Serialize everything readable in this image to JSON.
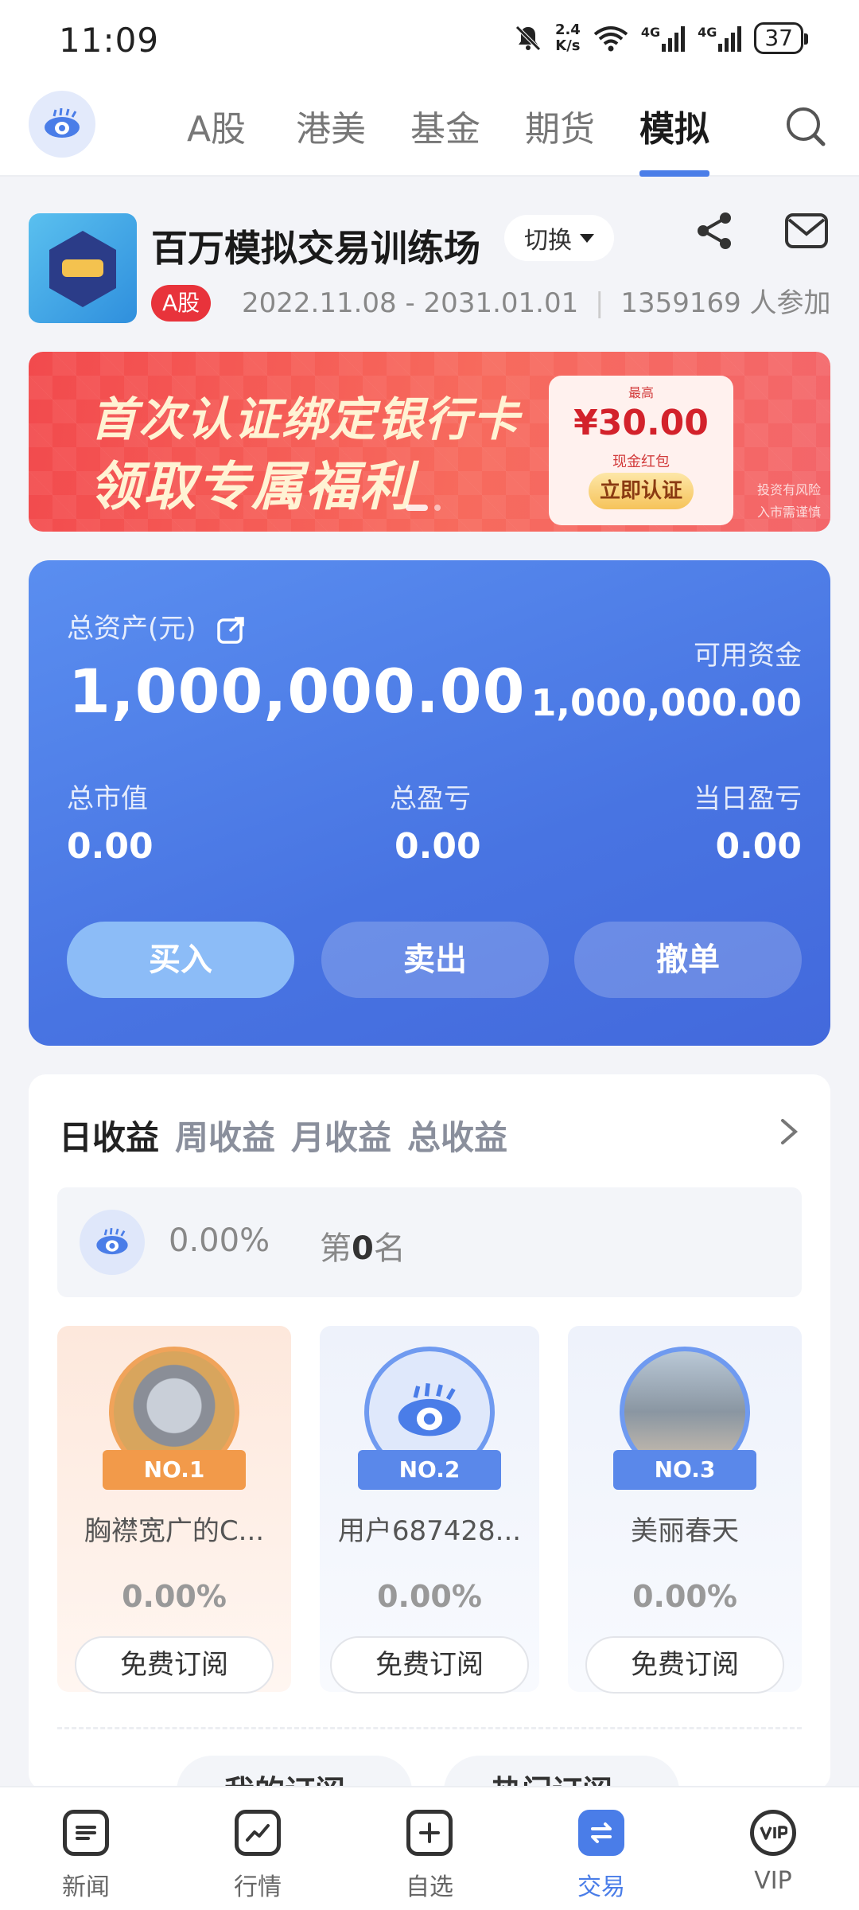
{
  "status_bar": {
    "time": "11:09",
    "speed_top": "2.4",
    "speed_bottom": "K/s",
    "net1": "4G",
    "net2": "4G",
    "battery": "37"
  },
  "top_nav": {
    "tabs": [
      {
        "label": "A股"
      },
      {
        "label": "港美"
      },
      {
        "label": "基金"
      },
      {
        "label": "期货"
      },
      {
        "label": "模拟"
      }
    ],
    "active_tab": "模拟"
  },
  "contest": {
    "title": "百万模拟交易训练场",
    "switch_label": "切换",
    "market_tag": "A股",
    "period": "2022.11.08 - 2031.01.01",
    "separator": "|",
    "participants": "1359169 人参加"
  },
  "banner": {
    "line1": "首次认证绑定银行卡",
    "line2": "领取专属福利",
    "coupon_top": "最高",
    "coupon_amount": "¥30.00",
    "coupon_sub": "现金红包",
    "coupon_button": "立即认证",
    "risk_line1": "投资有风险",
    "risk_line2": "入市需谨慎"
  },
  "assets": {
    "total_label": "总资产(元)",
    "total_value": "1,000,000.00",
    "available_label": "可用资金",
    "available_value": "1,000,000.00",
    "market_value_label": "总市值",
    "market_value": "0.00",
    "total_pl_label": "总盈亏",
    "total_pl": "0.00",
    "daily_pl_label": "当日盈亏",
    "daily_pl": "0.00",
    "buy_label": "买入",
    "sell_label": "卖出",
    "cancel_label": "撤单"
  },
  "ranking": {
    "tabs": [
      "日收益",
      "周收益",
      "月收益",
      "总收益"
    ],
    "active_tab": "日收益",
    "my_return": "0.00%",
    "my_rank_prefix": "第",
    "my_rank": "0",
    "my_rank_suffix": "名",
    "leaders": [
      {
        "badge": "NO.1",
        "name": "胸襟宽广的C...",
        "return": "0.00%",
        "subscribe_label": "免费订阅"
      },
      {
        "badge": "NO.2",
        "name": "用户687428...",
        "return": "0.00%",
        "subscribe_label": "免费订阅"
      },
      {
        "badge": "NO.3",
        "name": "美丽春天",
        "return": "0.00%",
        "subscribe_label": "免费订阅"
      }
    ],
    "peek_buttons": [
      "我的订阅",
      "热门订阅"
    ]
  },
  "bottom_nav": {
    "items": [
      {
        "label": "新闻"
      },
      {
        "label": "行情"
      },
      {
        "label": "自选"
      },
      {
        "label": "交易"
      },
      {
        "label": "VIP"
      }
    ],
    "active": "交易"
  },
  "colors": {
    "accent": "#4a7de8",
    "card_blue": "#4874e2",
    "tag_red": "#e8333b",
    "gold_ribbon": "#f29a4a"
  }
}
